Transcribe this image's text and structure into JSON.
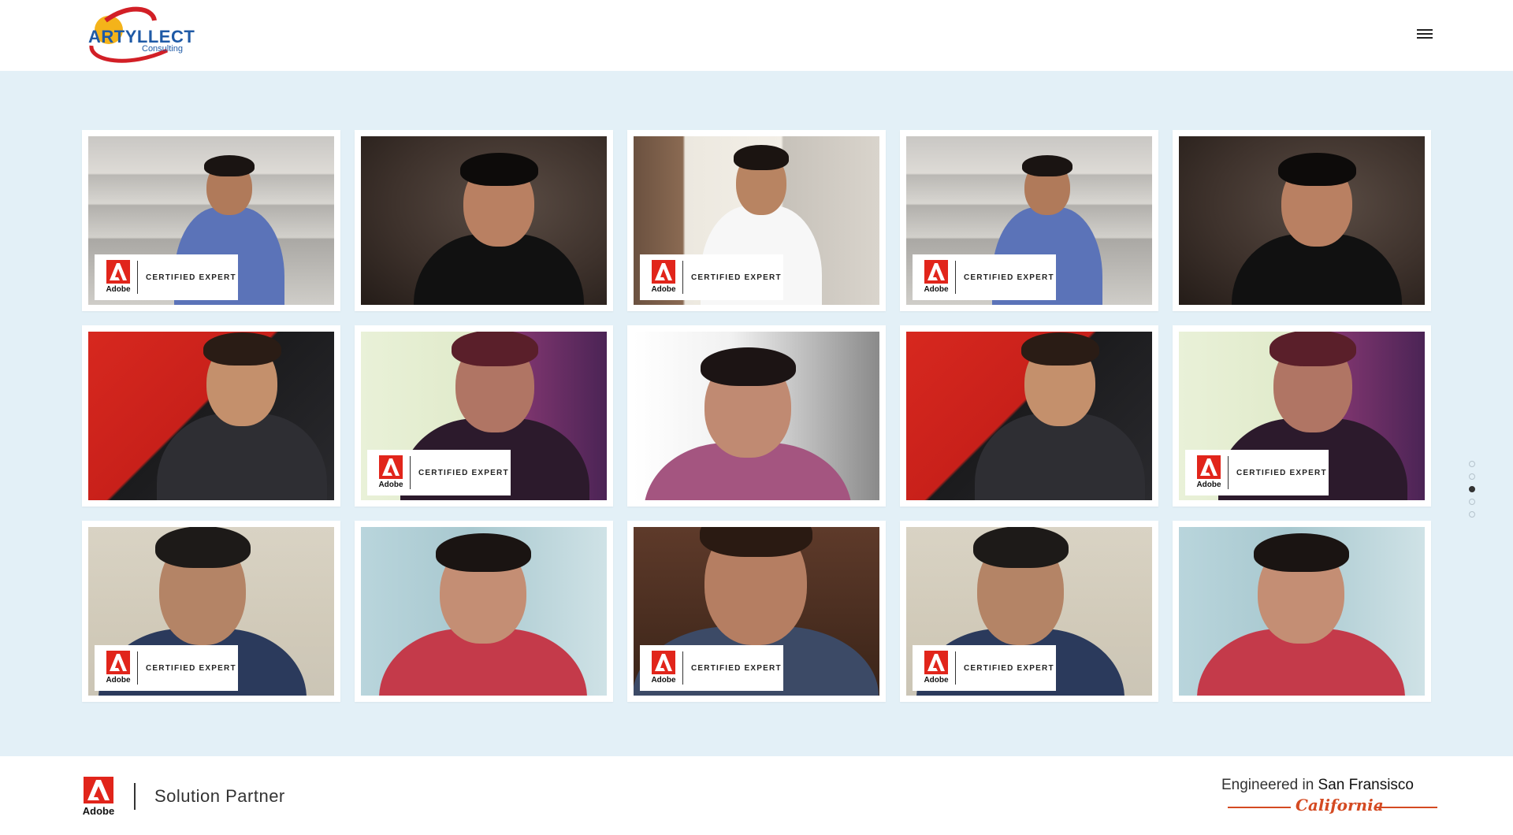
{
  "header": {
    "logo": {
      "name": "ARTYLLECT",
      "tagline": "Consulting"
    },
    "menu_icon": "hamburger-menu-icon"
  },
  "grid": {
    "badge": {
      "brand": "Adobe",
      "label": "CERTIFIED EXPERT"
    },
    "tiles": [
      {
        "photo": "steps",
        "certified": true
      },
      {
        "photo": "dark",
        "certified": false
      },
      {
        "photo": "sofa",
        "certified": true
      },
      {
        "photo": "steps",
        "certified": true
      },
      {
        "photo": "dark",
        "certified": false
      },
      {
        "photo": "red",
        "certified": false
      },
      {
        "photo": "green",
        "certified": true
      },
      {
        "photo": "lady",
        "certified": false
      },
      {
        "photo": "red",
        "certified": false
      },
      {
        "photo": "green",
        "certified": true
      },
      {
        "photo": "beige",
        "certified": true
      },
      {
        "photo": "teal",
        "certified": false
      },
      {
        "photo": "warm",
        "certified": true
      },
      {
        "photo": "beige",
        "certified": true
      },
      {
        "photo": "teal",
        "certified": false
      }
    ]
  },
  "pagination": {
    "count": 5,
    "active_index": 2
  },
  "footer": {
    "brand": "Adobe",
    "partner_label": "Solution Partner",
    "engineered_prefix": "Engineered in",
    "engineered_city": "San Fransisco",
    "engineered_state": "California"
  },
  "colors": {
    "accent_red": "#e1251b",
    "background_band": "#e3f0f7",
    "logo_blue": "#1f5aa6",
    "california_orange": "#d44a22"
  }
}
